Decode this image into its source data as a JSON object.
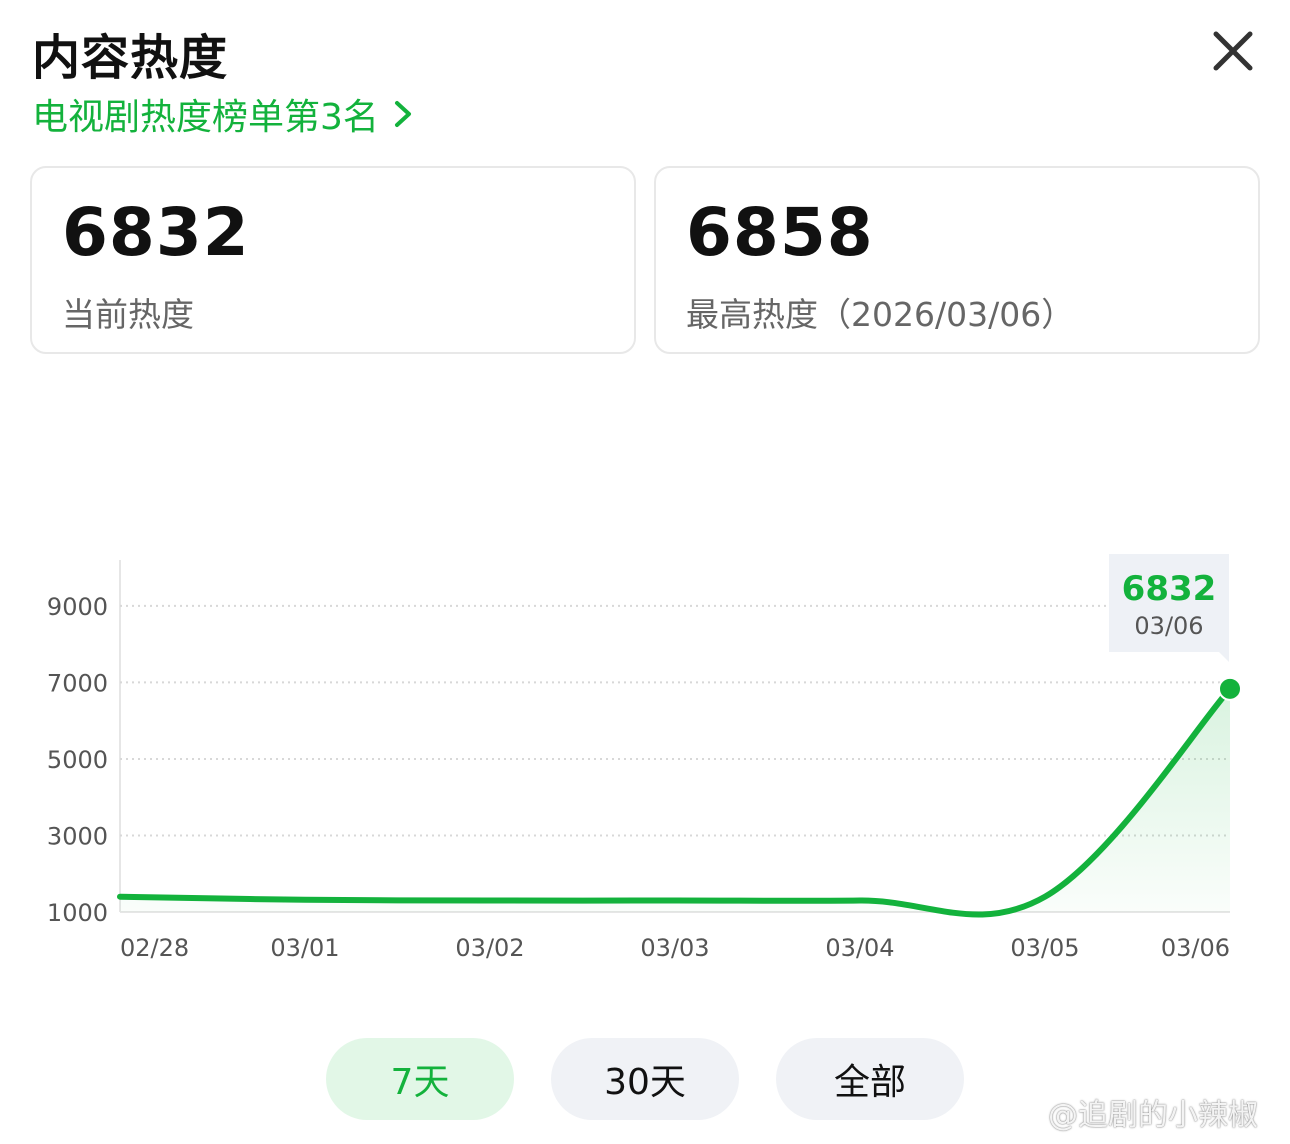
{
  "header": {
    "title": "内容热度",
    "rank_text": "电视剧热度榜单第3名"
  },
  "stats": {
    "current": {
      "value": "6832",
      "label": "当前热度"
    },
    "peak": {
      "value": "6858",
      "label": "最高热度（2026/03/06）"
    }
  },
  "tooltip": {
    "value": "6832",
    "date": "03/06"
  },
  "chart_data": {
    "type": "area",
    "x": [
      "02/28",
      "03/01",
      "03/02",
      "03/03",
      "03/04",
      "03/05",
      "03/06"
    ],
    "series": [
      {
        "values": [
          1400,
          1320,
          1300,
          1300,
          1300,
          1400,
          6832
        ]
      }
    ],
    "yticks": [
      1000,
      3000,
      5000,
      7000,
      9000
    ],
    "ylim": [
      1000,
      10200
    ],
    "grid": true,
    "line_color": "#13b23c"
  },
  "filters": [
    {
      "label": "7天",
      "selected": true
    },
    {
      "label": "30天",
      "selected": false
    },
    {
      "label": "全部",
      "selected": false
    }
  ],
  "watermark": {
    "text": "@追剧的小辣椒"
  },
  "colors": {
    "accent": "#13b23c",
    "selected_pill_bg": "#e2f7e7",
    "pill_bg": "#f0f2f6"
  }
}
